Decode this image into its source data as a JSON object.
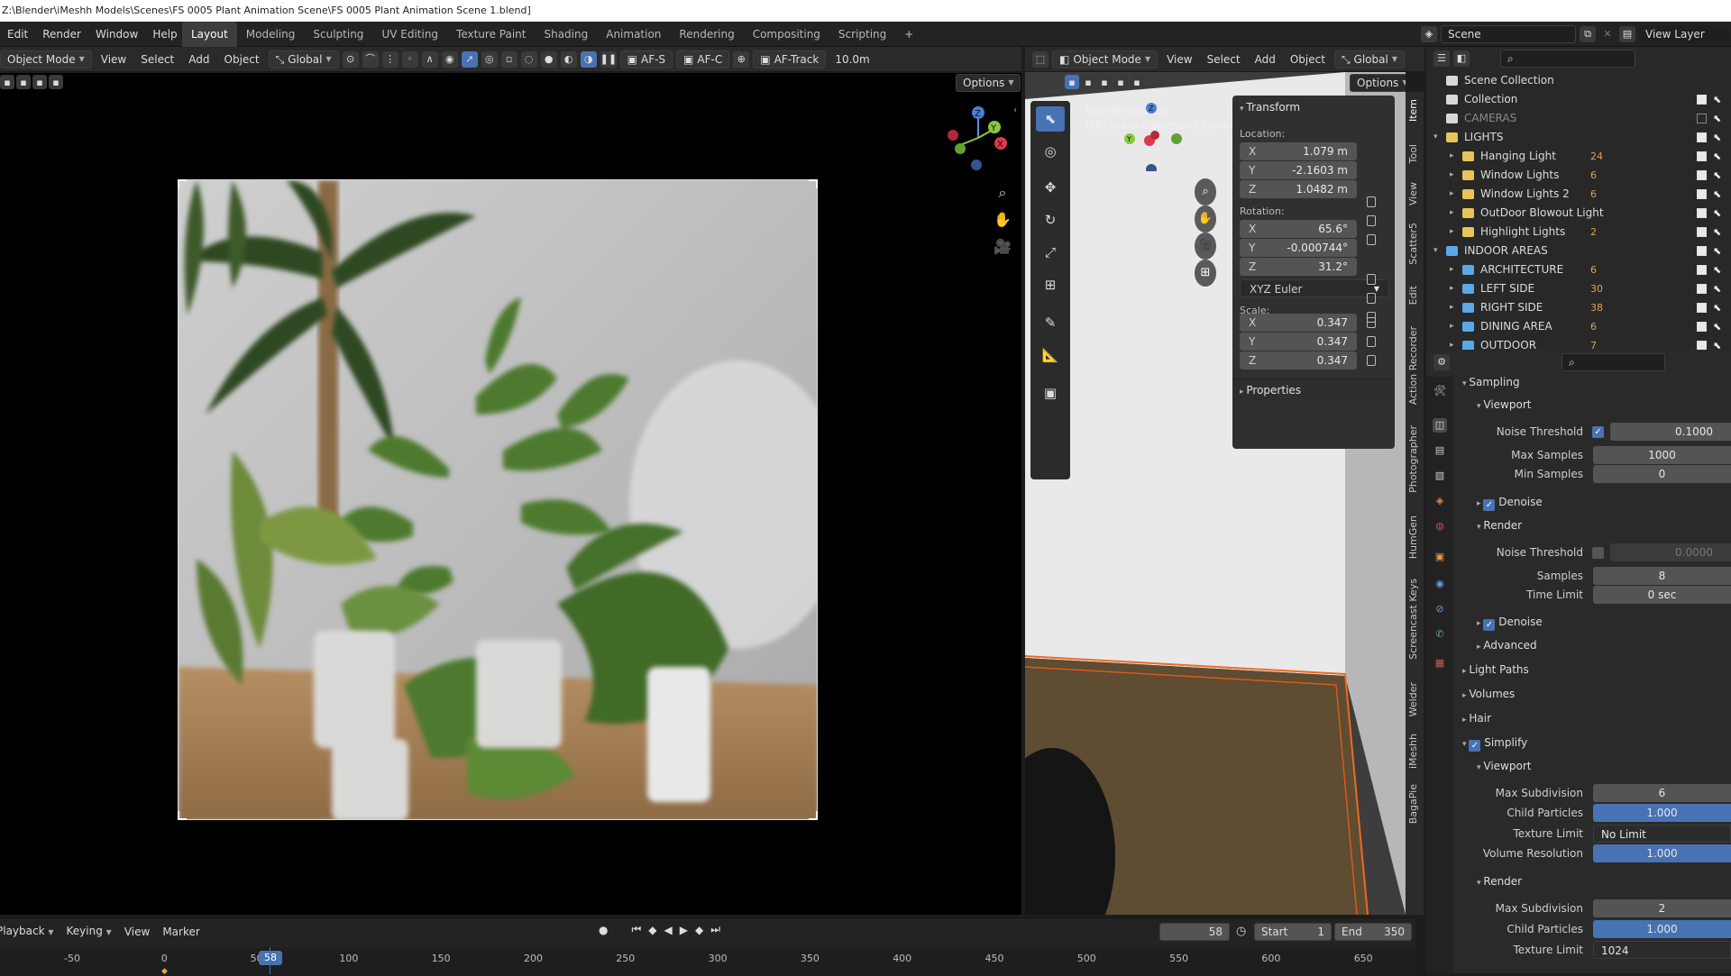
{
  "titlebar": {
    "path": "Z:\\Blender\\iMeshh Models\\Scenes\\FS 0005 Plant Animation Scene\\FS 0005 Plant Animation Scene 1.blend]"
  },
  "menus": [
    "Edit",
    "Render",
    "Window",
    "Help"
  ],
  "workspaces": [
    "Layout",
    "Modeling",
    "Sculpting",
    "UV Editing",
    "Texture Paint",
    "Shading",
    "Animation",
    "Rendering",
    "Compositing",
    "Scripting"
  ],
  "workspace_active": "Layout",
  "add_workspace": "+",
  "scene": {
    "label": "Scene",
    "view_layer": "View Layer"
  },
  "left_header": {
    "mode": "Object Mode",
    "menus": [
      "View",
      "Select",
      "Add",
      "Object"
    ],
    "orientation": "Global",
    "af_s": "AF-S",
    "af_c": "AF-C",
    "af_track": "AF-Track",
    "distance": "10.0m",
    "options": "Options"
  },
  "right_header": {
    "mode": "Object Mode",
    "menus": [
      "View",
      "Select",
      "Add",
      "Object"
    ],
    "orientation": "Global",
    "options": "Options"
  },
  "viewport_overlay": {
    "perspective": "User Perspective",
    "context": "(58) Scene Collection | Camera"
  },
  "transform": {
    "title": "Transform",
    "location_label": "Location:",
    "location": [
      {
        "axis": "X",
        "value": "1.079 m"
      },
      {
        "axis": "Y",
        "value": "-2.1603 m"
      },
      {
        "axis": "Z",
        "value": "1.0482 m"
      }
    ],
    "rotation_label": "Rotation:",
    "rotation": [
      {
        "axis": "X",
        "value": "65.6°"
      },
      {
        "axis": "Y",
        "value": "-0.000744°"
      },
      {
        "axis": "Z",
        "value": "31.2°"
      }
    ],
    "rotation_mode": "XYZ Euler",
    "scale_label": "Scale:",
    "scale": [
      {
        "axis": "X",
        "value": "0.347"
      },
      {
        "axis": "Y",
        "value": "0.347"
      },
      {
        "axis": "Z",
        "value": "0.347"
      }
    ],
    "properties": "Properties"
  },
  "side_tabs": [
    "Item",
    "Tool",
    "View",
    "Scatter5",
    "Edit",
    "Action Recorder",
    "Photographer",
    "HumGen",
    "Screencast Keys",
    "Welder",
    "iMeshh",
    "BagaPie"
  ],
  "outliner": {
    "root": "Scene Collection",
    "rows": [
      {
        "name": "Collection",
        "indent": 1,
        "tri": "",
        "color": "#d8d8d8",
        "checked": true,
        "badge": ""
      },
      {
        "name": "CAMERAS",
        "indent": 1,
        "tri": "",
        "color": "#d8d8d8",
        "checked": false,
        "badge": "",
        "dim": true
      },
      {
        "name": "LIGHTS",
        "indent": 1,
        "tri": "▾",
        "color": "#e8c45a",
        "checked": true,
        "badge": ""
      },
      {
        "name": "Hanging Light",
        "indent": 2,
        "tri": "▸",
        "color": "#e8c45a",
        "checked": true,
        "badge": "24"
      },
      {
        "name": "Window Lights",
        "indent": 2,
        "tri": "▸",
        "color": "#e8c45a",
        "checked": true,
        "badge": "6"
      },
      {
        "name": "Window Lights 2",
        "indent": 2,
        "tri": "▸",
        "color": "#e8c45a",
        "checked": true,
        "badge": "6"
      },
      {
        "name": "OutDoor Blowout Light",
        "indent": 2,
        "tri": "▸",
        "color": "#e8c45a",
        "checked": true,
        "badge": ""
      },
      {
        "name": "Highlight Lights",
        "indent": 2,
        "tri": "▸",
        "color": "#e8c45a",
        "checked": true,
        "badge": "2"
      },
      {
        "name": "INDOOR AREAS",
        "indent": 1,
        "tri": "▾",
        "color": "#5aa8e8",
        "checked": true,
        "badge": ""
      },
      {
        "name": "ARCHITECTURE",
        "indent": 2,
        "tri": "▸",
        "color": "#5aa8e8",
        "checked": true,
        "badge": "6"
      },
      {
        "name": "LEFT SIDE",
        "indent": 2,
        "tri": "▸",
        "color": "#5aa8e8",
        "checked": true,
        "badge": "30"
      },
      {
        "name": "RIGHT SIDE",
        "indent": 2,
        "tri": "▸",
        "color": "#5aa8e8",
        "checked": true,
        "badge": "38"
      },
      {
        "name": "DINING AREA",
        "indent": 2,
        "tri": "▸",
        "color": "#5aa8e8",
        "checked": true,
        "badge": "6"
      },
      {
        "name": "OUTDOOR",
        "indent": 2,
        "tri": "▸",
        "color": "#5aa8e8",
        "checked": true,
        "badge": "7"
      }
    ]
  },
  "properties": {
    "sampling": "Sampling",
    "viewport": "Viewport",
    "noise_threshold_label": "Noise Threshold",
    "noise_threshold": "0.1000",
    "max_samples_label": "Max Samples",
    "max_samples": "1000",
    "min_samples_label": "Min Samples",
    "min_samples": "0",
    "denoise": "Denoise",
    "render": "Render",
    "render_noise_threshold": "0.0000",
    "samples_label": "Samples",
    "samples": "8",
    "time_limit_label": "Time Limit",
    "time_limit": "0 sec",
    "advanced": "Advanced",
    "light_paths": "Light Paths",
    "volumes": "Volumes",
    "hair": "Hair",
    "simplify": "Simplify",
    "max_subdivision_label": "Max Subdivision",
    "vp_max_subdivision": "6",
    "child_particles_label": "Child Particles",
    "vp_child_particles": "1.000",
    "texture_limit_label": "Texture Limit",
    "vp_texture_limit": "No Limit",
    "volume_resolution_label": "Volume Resolution",
    "vp_volume_resolution": "1.000",
    "r_max_subdivision": "2",
    "r_child_particles": "1.000",
    "r_texture_limit": "1024"
  },
  "timeline": {
    "menus": [
      "Playback",
      "Keying",
      "View",
      "Marker"
    ],
    "current_frame": "58",
    "start_label": "Start",
    "start": "1",
    "end_label": "End",
    "end": "350",
    "ticks": [
      "-50",
      "0",
      "50",
      "100",
      "150",
      "200",
      "250",
      "300",
      "350",
      "400",
      "450",
      "500",
      "550",
      "600",
      "650"
    ]
  }
}
